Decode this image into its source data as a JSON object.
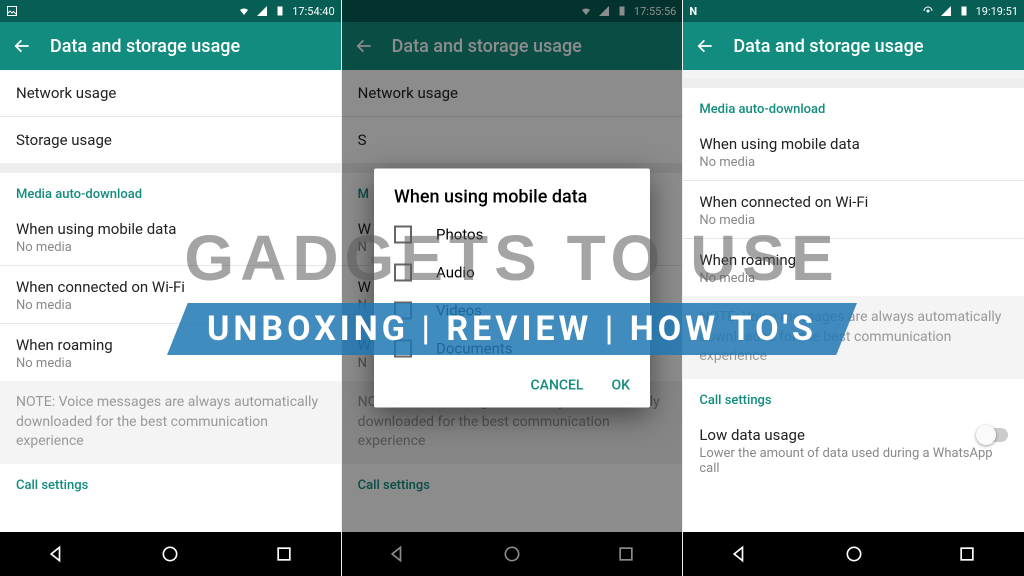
{
  "watermark": {
    "line1": "GADGETS TO USE",
    "line2": "UNBOXING | REVIEW | HOW TO'S"
  },
  "screens": {
    "left": {
      "status_time": "17:54:40",
      "title": "Data and storage usage",
      "network_usage": "Network usage",
      "storage_usage": "Storage usage",
      "section_media": "Media auto-download",
      "mobile_title": "When using mobile data",
      "mobile_sub": "No media",
      "wifi_title": "When connected on Wi-Fi",
      "wifi_sub": "No media",
      "roaming_title": "When roaming",
      "roaming_sub": "No media",
      "note": "NOTE: Voice messages are always automatically downloaded for the best communication experience",
      "section_calls": "Call settings"
    },
    "mid": {
      "status_time": "17:55:56",
      "title": "Data and storage usage",
      "network_usage": "Network usage",
      "dialog_title": "When using mobile data",
      "opt1": "Photos",
      "opt2": "Audio",
      "opt3": "Videos",
      "opt4": "Documents",
      "cancel": "CANCEL",
      "ok": "OK",
      "note": "NOTE: Voice messages are always automatically downloaded for the best communication experience",
      "section_calls": "Call settings"
    },
    "right": {
      "status_time": "19:19:51",
      "title": "Data and storage usage",
      "section_media": "Media auto-download",
      "mobile_title": "When using mobile data",
      "mobile_sub": "No media",
      "wifi_title": "When connected on Wi-Fi",
      "wifi_sub": "No media",
      "roaming_title": "When roaming",
      "roaming_sub": "No media",
      "note": "NOTE: Voice messages are always automatically downloaded for the best communication experience",
      "section_calls": "Call settings",
      "low_title": "Low data usage",
      "low_sub": "Lower the amount of data used during a WhatsApp call"
    }
  }
}
